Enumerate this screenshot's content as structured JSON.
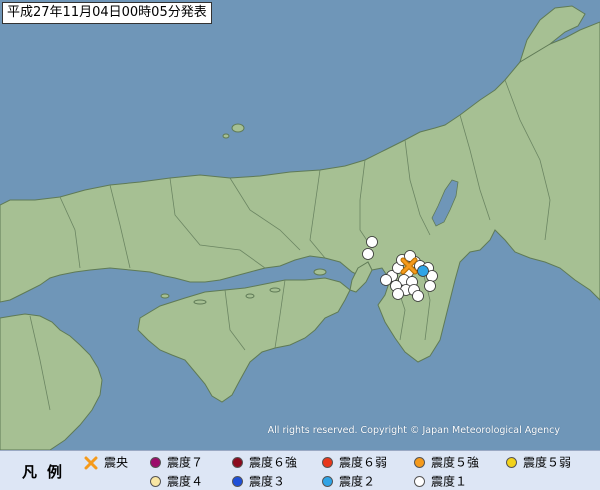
{
  "title": "平成27年11月04日00時05分発表",
  "copyright": "All rights reserved. Copyright © Japan Meteorological Agency",
  "colors": {
    "sea": "#6f96b8",
    "land": "#a6c093",
    "border": "#6b8562",
    "lake": "#6f96b8"
  },
  "legend": {
    "heading": "凡例",
    "items": [
      {
        "label": "震央",
        "icon": "epicenter-x-icon",
        "color": "#f59a1b"
      },
      {
        "label": "震度７",
        "icon": "circle-icon",
        "color": "#9c0d6a"
      },
      {
        "label": "震度６強",
        "icon": "circle-icon",
        "color": "#8b0b1e"
      },
      {
        "label": "震度６弱",
        "icon": "circle-icon",
        "color": "#e8371b"
      },
      {
        "label": "震度５強",
        "icon": "circle-icon",
        "color": "#f59a1b"
      },
      {
        "label": "震度５弱",
        "icon": "circle-icon",
        "color": "#f2d21b"
      },
      {
        "label": "震度４",
        "icon": "circle-icon",
        "color": "#f8e6a3"
      },
      {
        "label": "震度３",
        "icon": "circle-icon",
        "color": "#1d4fd8"
      },
      {
        "label": "震度２",
        "icon": "circle-icon",
        "color": "#2fa4e6"
      },
      {
        "label": "震度１",
        "icon": "circle-icon",
        "color": "#ffffff"
      }
    ]
  },
  "observations": {
    "epicenter": {
      "intensity": "震央"
    },
    "stations": [
      {
        "intensity": "2"
      },
      {
        "intensity": "1"
      },
      {
        "intensity": "1"
      },
      {
        "intensity": "1"
      },
      {
        "intensity": "1"
      },
      {
        "intensity": "1"
      },
      {
        "intensity": "1"
      },
      {
        "intensity": "1"
      },
      {
        "intensity": "1"
      },
      {
        "intensity": "1"
      },
      {
        "intensity": "1"
      },
      {
        "intensity": "1"
      },
      {
        "intensity": "1"
      },
      {
        "intensity": "1"
      },
      {
        "intensity": "1"
      },
      {
        "intensity": "1"
      },
      {
        "intensity": "1"
      },
      {
        "intensity": "1"
      },
      {
        "intensity": "1"
      },
      {
        "intensity": "1"
      },
      {
        "intensity": "1"
      }
    ]
  }
}
